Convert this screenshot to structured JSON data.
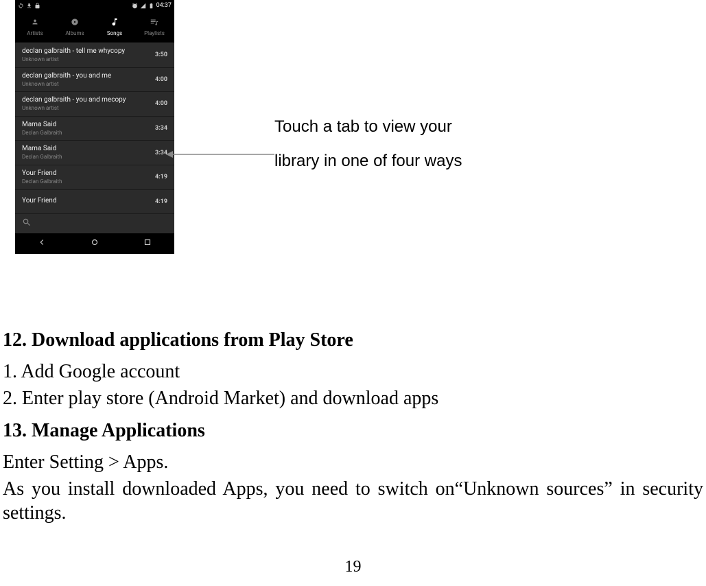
{
  "phone": {
    "status": {
      "time": "04:37"
    },
    "tabs": [
      {
        "label": "Artists",
        "icon": "🎤",
        "active": false
      },
      {
        "label": "Albums",
        "icon": "💿",
        "active": false
      },
      {
        "label": "Songs",
        "icon": "𝄞",
        "active": true
      },
      {
        "label": "Playlists",
        "icon": "≣",
        "active": false
      }
    ],
    "songs": [
      {
        "title": "declan galbraith - tell me whycopy",
        "artist": "Unknown artist",
        "duration": "3:50"
      },
      {
        "title": "declan galbraith - you and me",
        "artist": "Unknown artist",
        "duration": "4:00"
      },
      {
        "title": "declan galbraith - you and mecopy",
        "artist": "Unknown artist",
        "duration": "4:00"
      },
      {
        "title": "Mama Said",
        "artist": "Declan Galbraith",
        "duration": "3:34"
      },
      {
        "title": "Mama Said",
        "artist": "Declan Galbraith",
        "duration": "3:34"
      },
      {
        "title": "Your Friend",
        "artist": "Declan Galbraith",
        "duration": "4:19"
      },
      {
        "title": "Your Friend",
        "artist": "",
        "duration": "4:19"
      }
    ]
  },
  "callout": {
    "line1": "Touch a tab to view your",
    "line2": "library in one of four ways"
  },
  "doc": {
    "h12": "12. Download applications from Play Store",
    "step1": "1. Add Google account",
    "step2": "2. Enter play store (Android Market) and download apps",
    "h13": "13. Manage Applications",
    "p1": "Enter Setting > Apps.",
    "p2": "As you install downloaded Apps, you need to switch on“Unknown sources” in security settings.",
    "page": "19"
  }
}
